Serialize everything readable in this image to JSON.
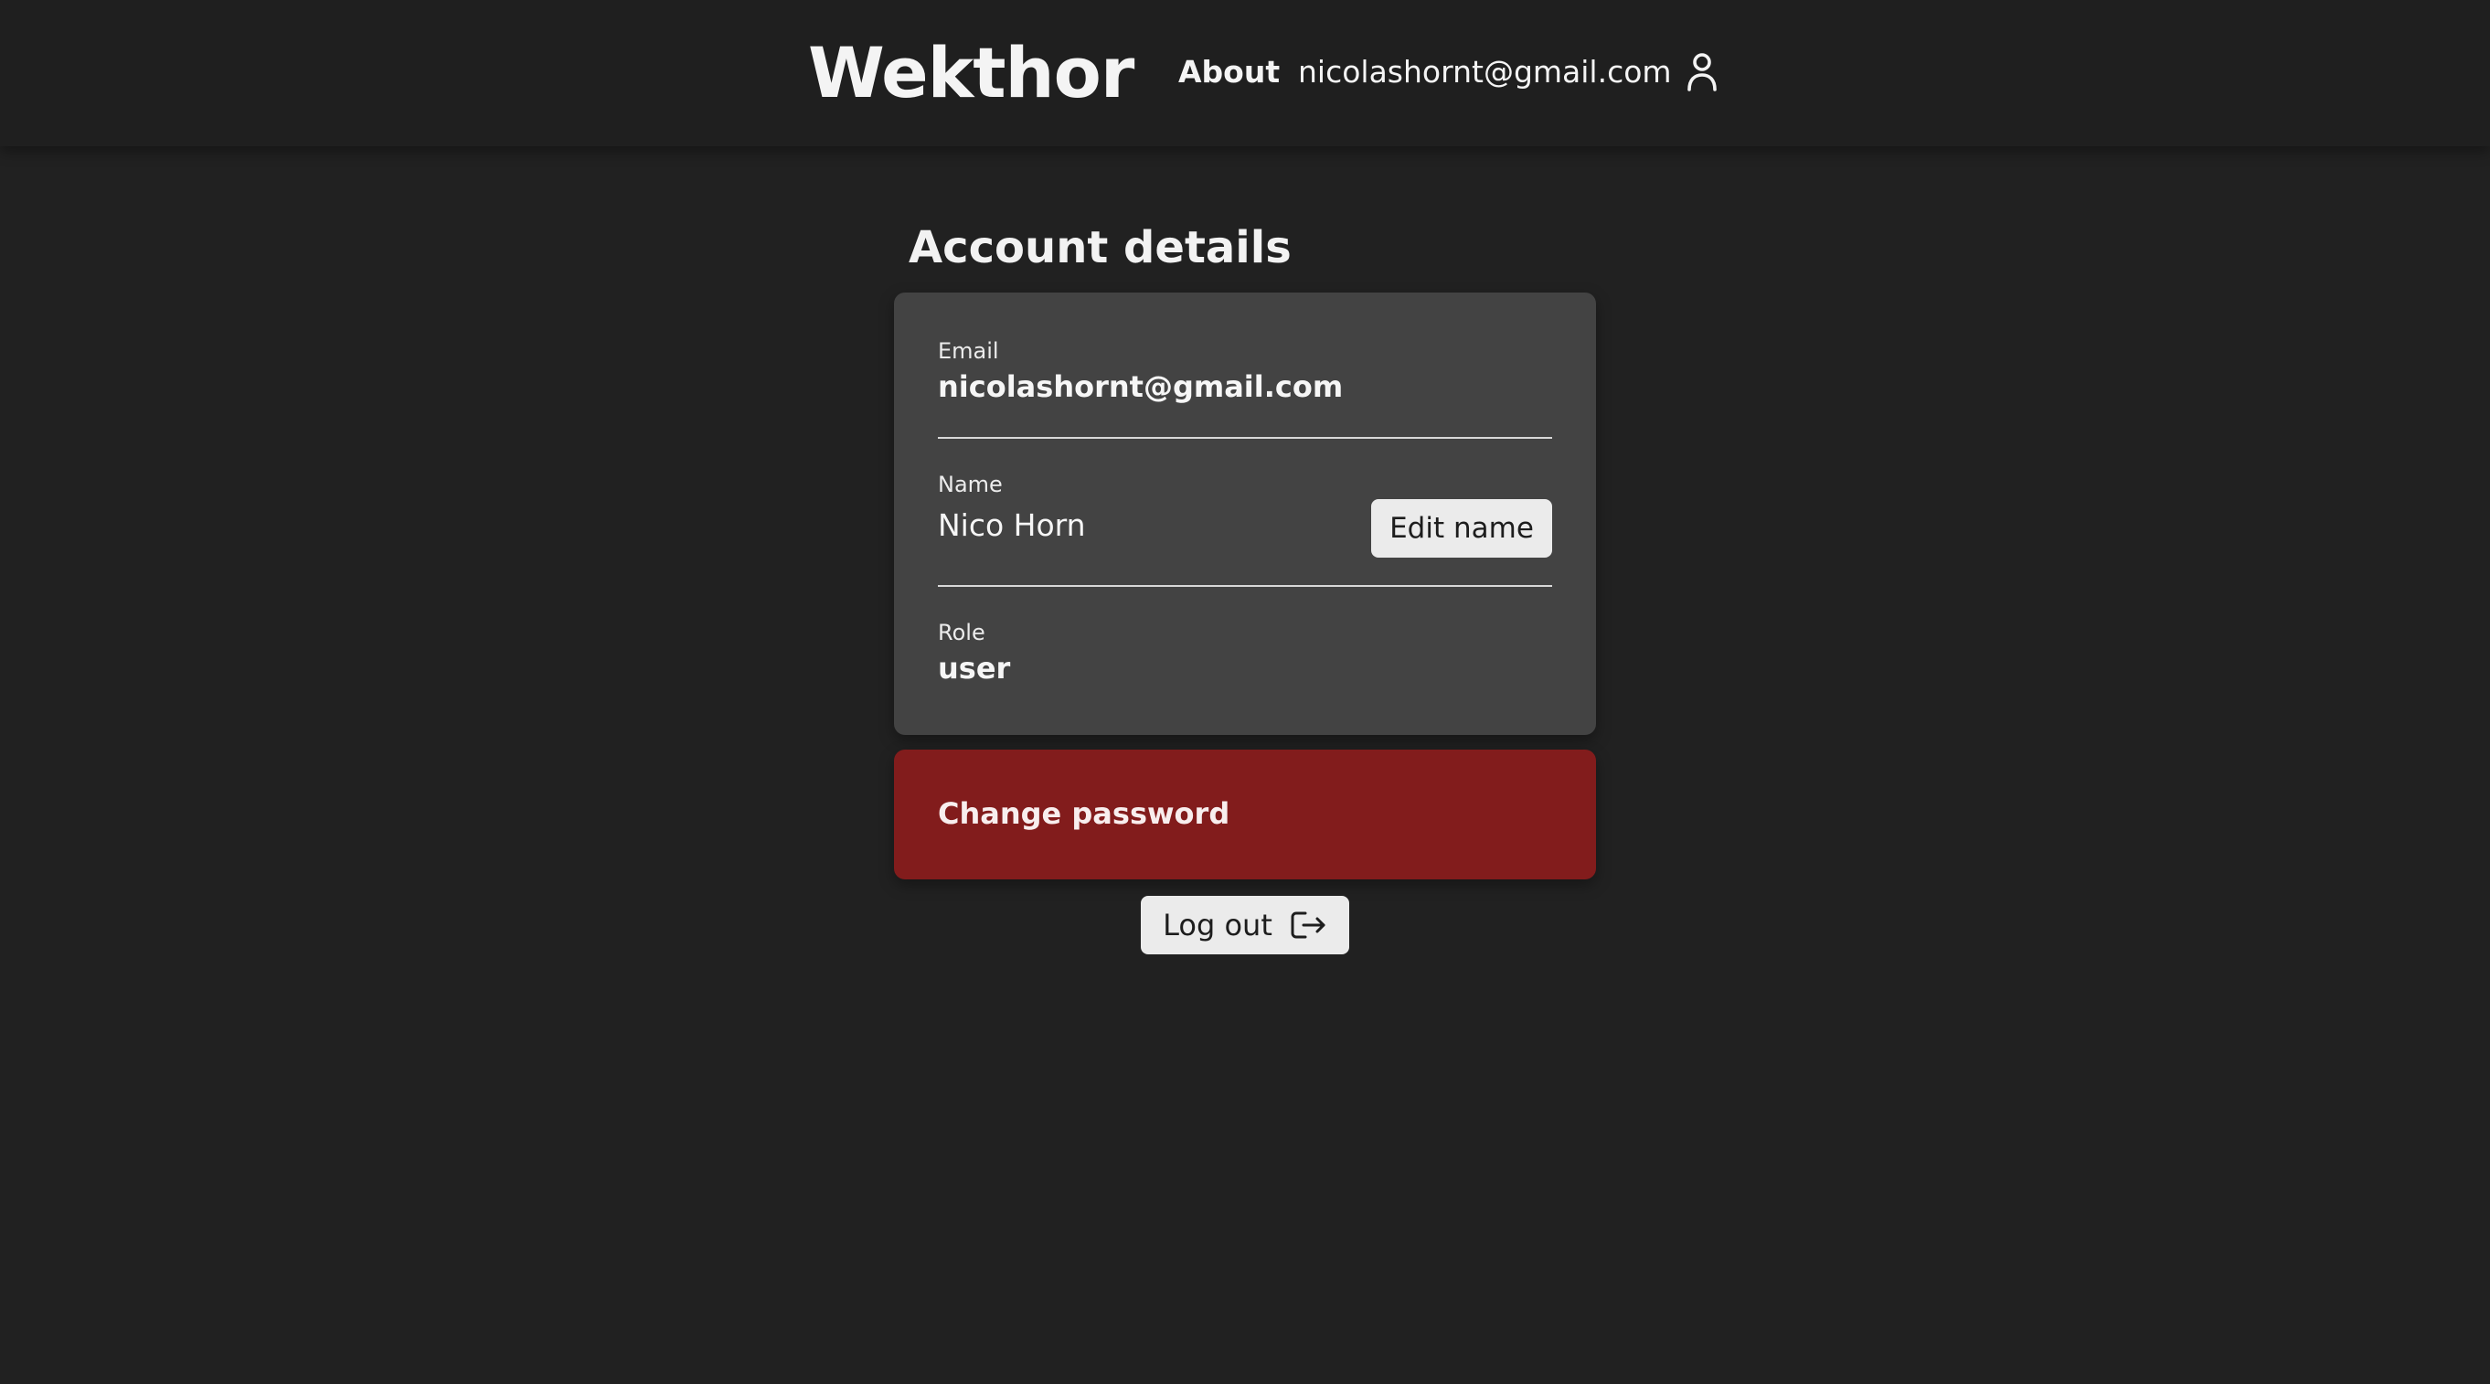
{
  "header": {
    "brand": "Wekthor",
    "nav_about": "About",
    "user_email": "nicolashornt@gmail.com",
    "user_icon": "user-icon"
  },
  "page": {
    "title": "Account details"
  },
  "account": {
    "email_label": "Email",
    "email_value": "nicolashornt@gmail.com",
    "name_label": "Name",
    "name_value": "Nico Horn",
    "edit_name_label": "Edit name",
    "role_label": "Role",
    "role_value": "user"
  },
  "password": {
    "label": "Change password"
  },
  "logout": {
    "label": "Log out",
    "icon": "logout-icon"
  },
  "colors": {
    "background": "#212121",
    "header": "#1f1f1f",
    "card": "#434343",
    "danger": "#821c1c",
    "button": "#ebebeb"
  }
}
